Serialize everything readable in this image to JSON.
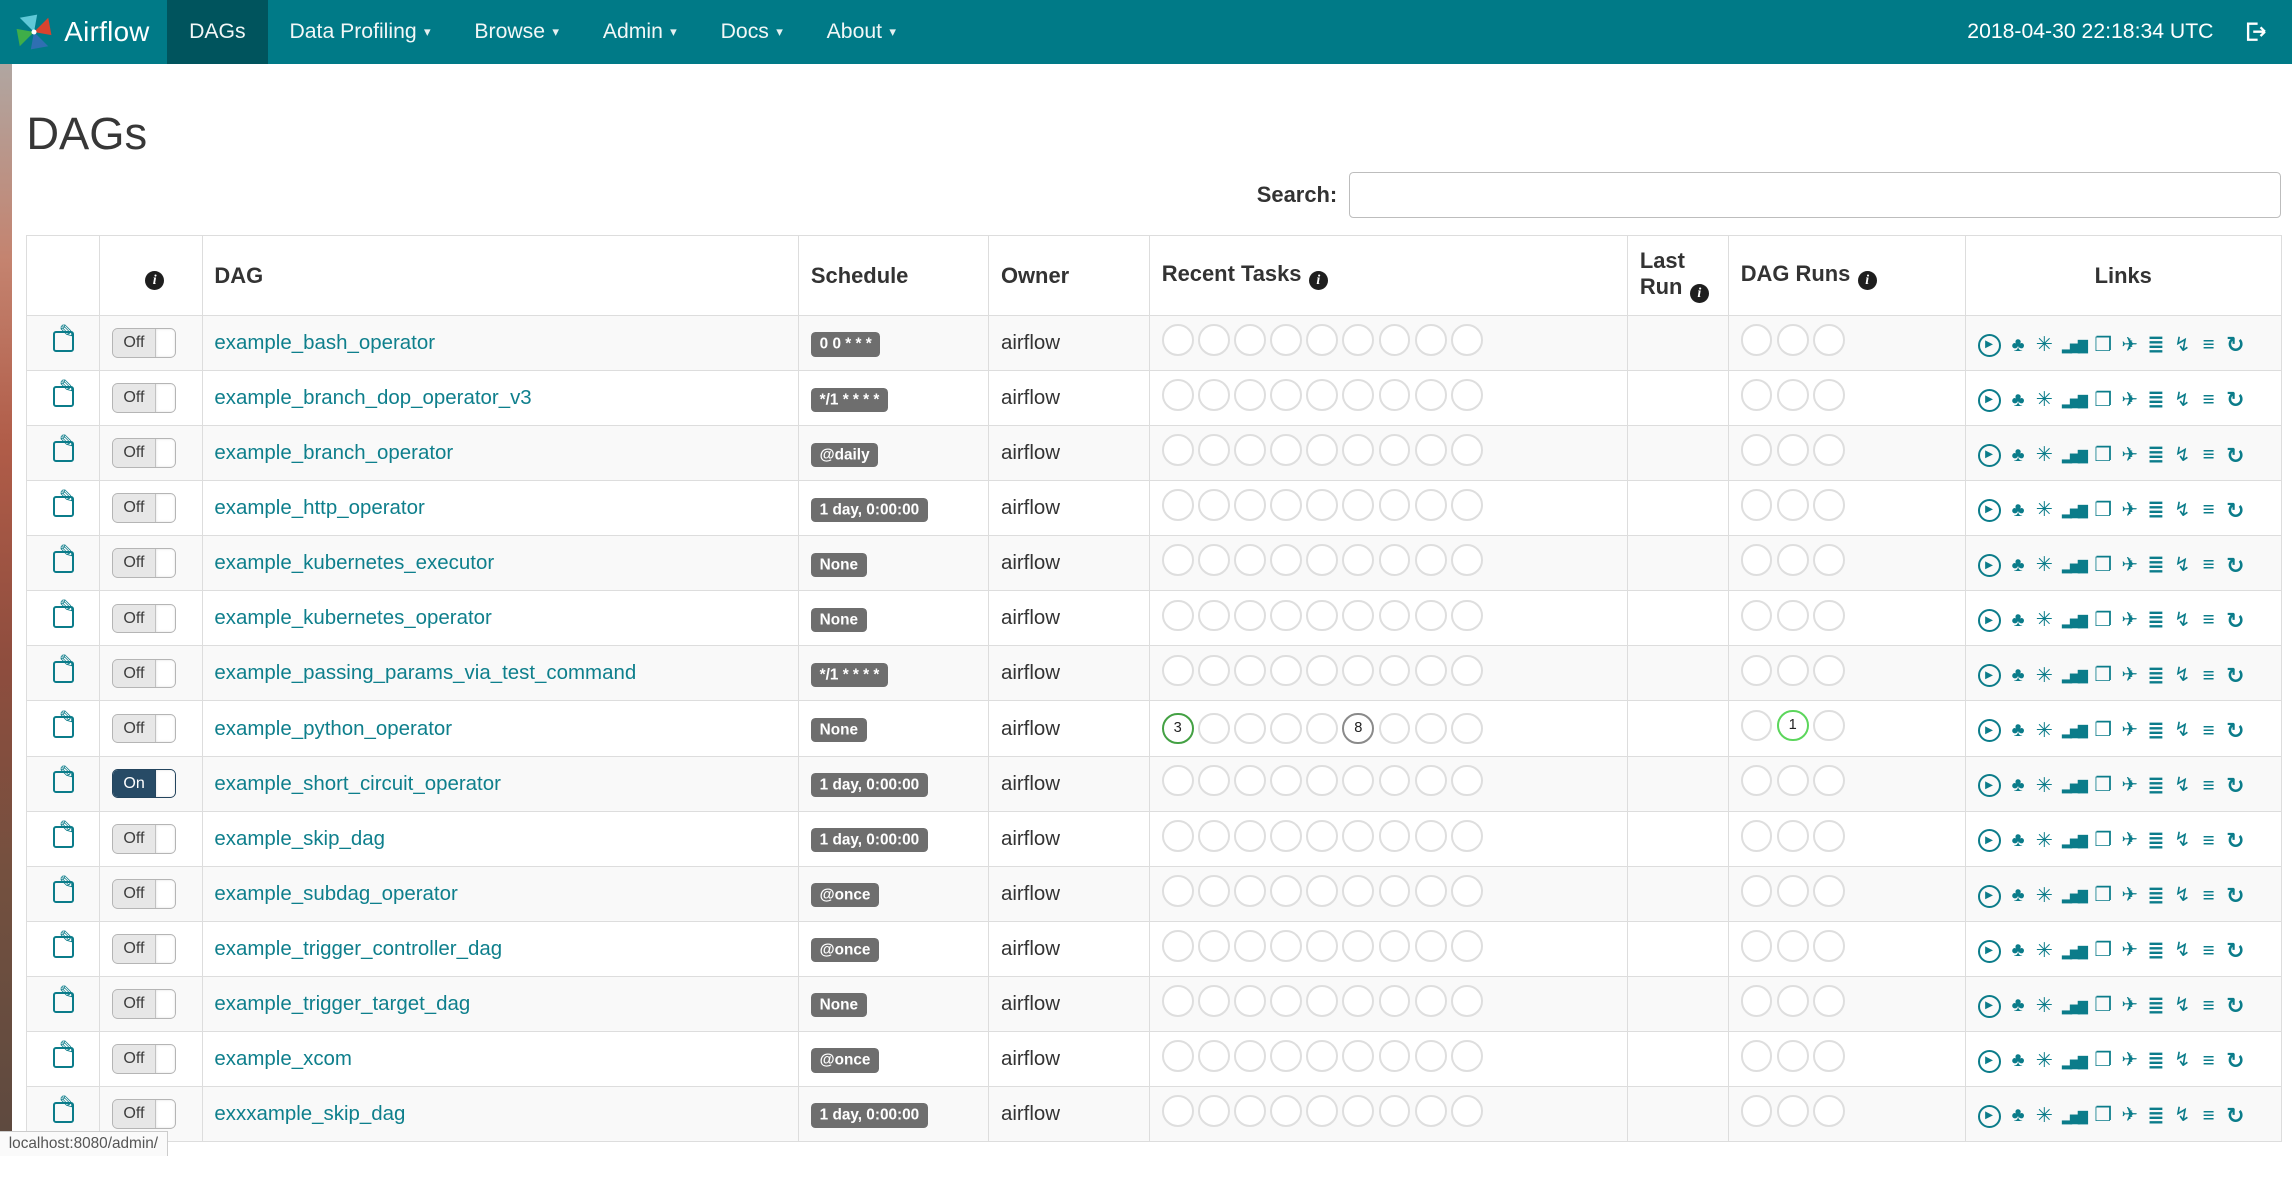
{
  "navbar": {
    "brand": "Airflow",
    "items": [
      {
        "label": "DAGs",
        "active": true
      },
      {
        "label": "Data Profiling"
      },
      {
        "label": "Browse"
      },
      {
        "label": "Admin"
      },
      {
        "label": "Docs"
      },
      {
        "label": "About"
      }
    ],
    "clock": "2018-04-30 22:18:34 UTC"
  },
  "page": {
    "title": "DAGs"
  },
  "search": {
    "label": "Search:",
    "value": ""
  },
  "table": {
    "columns": [
      {
        "label": ""
      },
      {
        "label": "",
        "info": true
      },
      {
        "label": "DAG"
      },
      {
        "label": "Schedule"
      },
      {
        "label": "Owner"
      },
      {
        "label": "Recent Tasks",
        "info": true
      },
      {
        "label": "Last Run",
        "info": true
      },
      {
        "label": "DAG Runs",
        "info": true
      },
      {
        "label": "Links"
      }
    ],
    "recent_task_circle_count": 9,
    "dag_run_circle_count": 3,
    "links": [
      {
        "name": "trigger-dag",
        "glyph": "▶"
      },
      {
        "name": "tree-view",
        "glyph": "♣"
      },
      {
        "name": "graph-view",
        "glyph": "✳"
      },
      {
        "name": "tasks-duration",
        "glyph": "▂▅▇"
      },
      {
        "name": "task-tries",
        "glyph": "❐"
      },
      {
        "name": "landing-times",
        "glyph": "✈"
      },
      {
        "name": "gantt",
        "glyph": "≣"
      },
      {
        "name": "code-view",
        "glyph": "↯"
      },
      {
        "name": "logs",
        "glyph": "≡"
      },
      {
        "name": "refresh",
        "glyph": "↻"
      }
    ],
    "rows": [
      {
        "dag": "example_bash_operator",
        "schedule": "0 0 * * *",
        "owner": "airflow",
        "paused_toggle": "Off",
        "recent_tasks": [],
        "dag_runs": []
      },
      {
        "dag": "example_branch_dop_operator_v3",
        "schedule": "*/1 * * * *",
        "owner": "airflow",
        "paused_toggle": "Off",
        "recent_tasks": [],
        "dag_runs": []
      },
      {
        "dag": "example_branch_operator",
        "schedule": "@daily",
        "owner": "airflow",
        "paused_toggle": "Off",
        "recent_tasks": [],
        "dag_runs": []
      },
      {
        "dag": "example_http_operator",
        "schedule": "1 day, 0:00:00",
        "owner": "airflow",
        "paused_toggle": "Off",
        "recent_tasks": [],
        "dag_runs": []
      },
      {
        "dag": "example_kubernetes_executor",
        "schedule": "None",
        "owner": "airflow",
        "paused_toggle": "Off",
        "recent_tasks": [],
        "dag_runs": []
      },
      {
        "dag": "example_kubernetes_operator",
        "schedule": "None",
        "owner": "airflow",
        "paused_toggle": "Off",
        "recent_tasks": [],
        "dag_runs": []
      },
      {
        "dag": "example_passing_params_via_test_command",
        "schedule": "*/1 * * * *",
        "owner": "airflow",
        "paused_toggle": "Off",
        "recent_tasks": [],
        "dag_runs": []
      },
      {
        "dag": "example_python_operator",
        "schedule": "None",
        "owner": "airflow",
        "paused_toggle": "Off",
        "recent_tasks": [
          {
            "index": 0,
            "value": "3",
            "color": "#44a144"
          },
          {
            "index": 5,
            "value": "8",
            "color": "#8a8a8a"
          }
        ],
        "dag_runs": [
          {
            "index": 1,
            "value": "1",
            "color": "#5cd65c"
          }
        ]
      },
      {
        "dag": "example_short_circuit_operator",
        "schedule": "1 day, 0:00:00",
        "owner": "airflow",
        "paused_toggle": "On",
        "recent_tasks": [],
        "dag_runs": []
      },
      {
        "dag": "example_skip_dag",
        "schedule": "1 day, 0:00:00",
        "owner": "airflow",
        "paused_toggle": "Off",
        "recent_tasks": [],
        "dag_runs": []
      },
      {
        "dag": "example_subdag_operator",
        "schedule": "@once",
        "owner": "airflow",
        "paused_toggle": "Off",
        "recent_tasks": [],
        "dag_runs": []
      },
      {
        "dag": "example_trigger_controller_dag",
        "schedule": "@once",
        "owner": "airflow",
        "paused_toggle": "Off",
        "recent_tasks": [],
        "dag_runs": []
      },
      {
        "dag": "example_trigger_target_dag",
        "schedule": "None",
        "owner": "airflow",
        "paused_toggle": "Off",
        "recent_tasks": [],
        "dag_runs": []
      },
      {
        "dag": "example_xcom",
        "schedule": "@once",
        "owner": "airflow",
        "paused_toggle": "Off",
        "recent_tasks": [],
        "dag_runs": []
      },
      {
        "dag": "exxxample_skip_dag",
        "schedule": "1 day, 0:00:00",
        "owner": "airflow",
        "paused_toggle": "Off",
        "recent_tasks": [],
        "dag_runs": []
      }
    ]
  },
  "statusbar": {
    "text": "localhost:8080/admin/"
  },
  "colors": {
    "navbar": "#007a87",
    "navbar_active": "#00545d",
    "accent": "#0b7c8a",
    "success": "#44a144",
    "running": "#5cd65c",
    "queued": "#8a8a8a"
  }
}
